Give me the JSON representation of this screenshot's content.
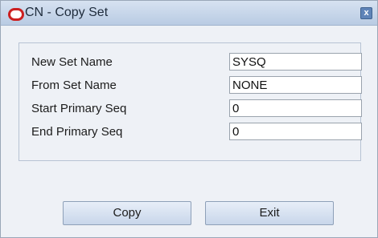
{
  "window": {
    "title": "CN - Copy Set",
    "close_symbol": "x"
  },
  "form": {
    "fields": [
      {
        "label": "New Set Name",
        "value": "SYSQ"
      },
      {
        "label": "From Set Name",
        "value": "NONE"
      },
      {
        "label": "Start Primary Seq",
        "value": "0"
      },
      {
        "label": "End Primary Seq",
        "value": "0"
      }
    ]
  },
  "buttons": {
    "copy": "Copy",
    "exit": "Exit"
  }
}
